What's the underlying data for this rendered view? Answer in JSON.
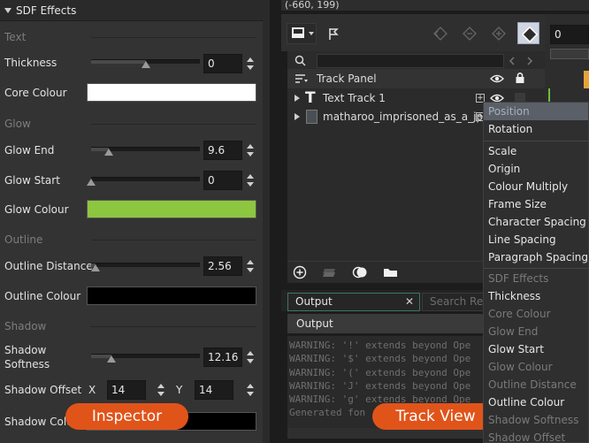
{
  "inspector": {
    "header_title": "SDF Effects",
    "pill_label": "Inspector",
    "sections": {
      "text": "Text",
      "glow": "Glow",
      "outline": "Outline",
      "shadow": "Shadow"
    },
    "thickness": {
      "label": "Thickness",
      "value": "0",
      "slider_fraction": 0.5
    },
    "core_colour": {
      "label": "Core Colour",
      "color": "#ffffff"
    },
    "glow_end": {
      "label": "Glow End",
      "value": "9.6",
      "slider_fraction": 0.16
    },
    "glow_start": {
      "label": "Glow Start",
      "value": "0",
      "slider_fraction": 0.0
    },
    "glow_colour": {
      "label": "Glow Colour",
      "color": "#8dc63f"
    },
    "outline_distance": {
      "label": "Outline Distance",
      "value": "2.56",
      "slider_fraction": 0.04
    },
    "outline_colour": {
      "label": "Outline Colour",
      "color": "#000000"
    },
    "shadow_softness": {
      "label_line1": "Shadow",
      "label_line2": "Softness",
      "value": "12.16",
      "slider_fraction": 0.19
    },
    "shadow_offset": {
      "label": "Shadow Offset",
      "x_label": "X",
      "x_value": "14",
      "y_label": "Y",
      "y_value": "14"
    },
    "shadow_colour": {
      "label": "Shadow Colour",
      "color": "#000000"
    }
  },
  "track_view": {
    "coords": "(-660, 199)",
    "pill_label": "Track View",
    "frame_value": "0",
    "track_panel_title": "Track Panel",
    "tracks": [
      {
        "name": "Text Track 1",
        "icon": "text-T-icon"
      },
      {
        "name": "matharoo_imprisoned_as_a_jpeg",
        "icon": "sprite-thumbnail-icon"
      }
    ],
    "output": {
      "tab_label": "Output",
      "search_tab_label": "Search Res",
      "title": "Output",
      "log": [
        "WARNING: '!' extends beyond Ope",
        "WARNING: '$' extends beyond Ope",
        "WARNING: '(' extends beyond Ope",
        "WARNING: 'J' extends beyond Ope",
        "WARNING: 'g' extends beyond Ope",
        "Generated fon"
      ]
    }
  },
  "menu": {
    "items": [
      {
        "label": "Position",
        "state": "hover"
      },
      {
        "label": "Rotation",
        "state": "enabled"
      },
      {
        "label": "Scale",
        "state": "enabled"
      },
      {
        "label": "Origin",
        "state": "enabled"
      },
      {
        "label": "Colour Multiply",
        "state": "enabled"
      },
      {
        "label": "Frame Size",
        "state": "enabled"
      },
      {
        "label": "Character Spacing",
        "state": "enabled"
      },
      {
        "label": "Line Spacing",
        "state": "enabled"
      },
      {
        "label": "Paragraph Spacing",
        "state": "enabled"
      },
      {
        "label": "SDF Effects",
        "state": "disabled"
      },
      {
        "label": "Thickness",
        "state": "enabled"
      },
      {
        "label": "Core Colour",
        "state": "disabled"
      },
      {
        "label": "Glow End",
        "state": "disabled"
      },
      {
        "label": "Glow Start",
        "state": "enabled"
      },
      {
        "label": "Glow Colour",
        "state": "disabled"
      },
      {
        "label": "Outline Distance",
        "state": "disabled"
      },
      {
        "label": "Outline Colour",
        "state": "enabled"
      },
      {
        "label": "Shadow Softness",
        "state": "disabled"
      },
      {
        "label": "Shadow Offset",
        "state": "disabled"
      }
    ]
  },
  "colors": {
    "accent_orange": "#e0541a",
    "menu_hover": "#5a5f68",
    "disabled_text": "#7a7a7a",
    "enabled_text": "#e6e6e6"
  }
}
